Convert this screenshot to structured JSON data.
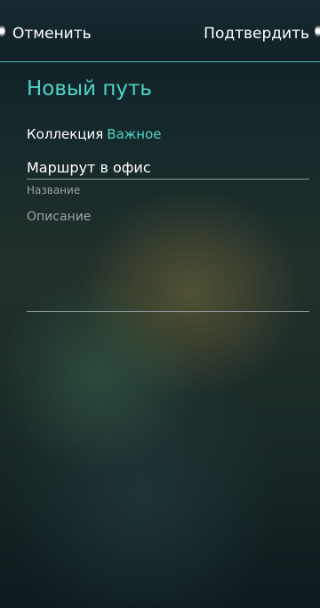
{
  "header": {
    "cancel_label": "Отменить",
    "accept_label": "Подтвердить"
  },
  "page": {
    "title": "Новый путь"
  },
  "collection": {
    "label": "Коллекция",
    "value": "Важное"
  },
  "name_field": {
    "value": "Маршрут в офис",
    "label": "Название"
  },
  "description_field": {
    "placeholder": "Описание",
    "value": ""
  },
  "colors": {
    "accent": "#4fd3c9",
    "text": "#ffffff",
    "secondary_text": "#9aa3a3"
  }
}
